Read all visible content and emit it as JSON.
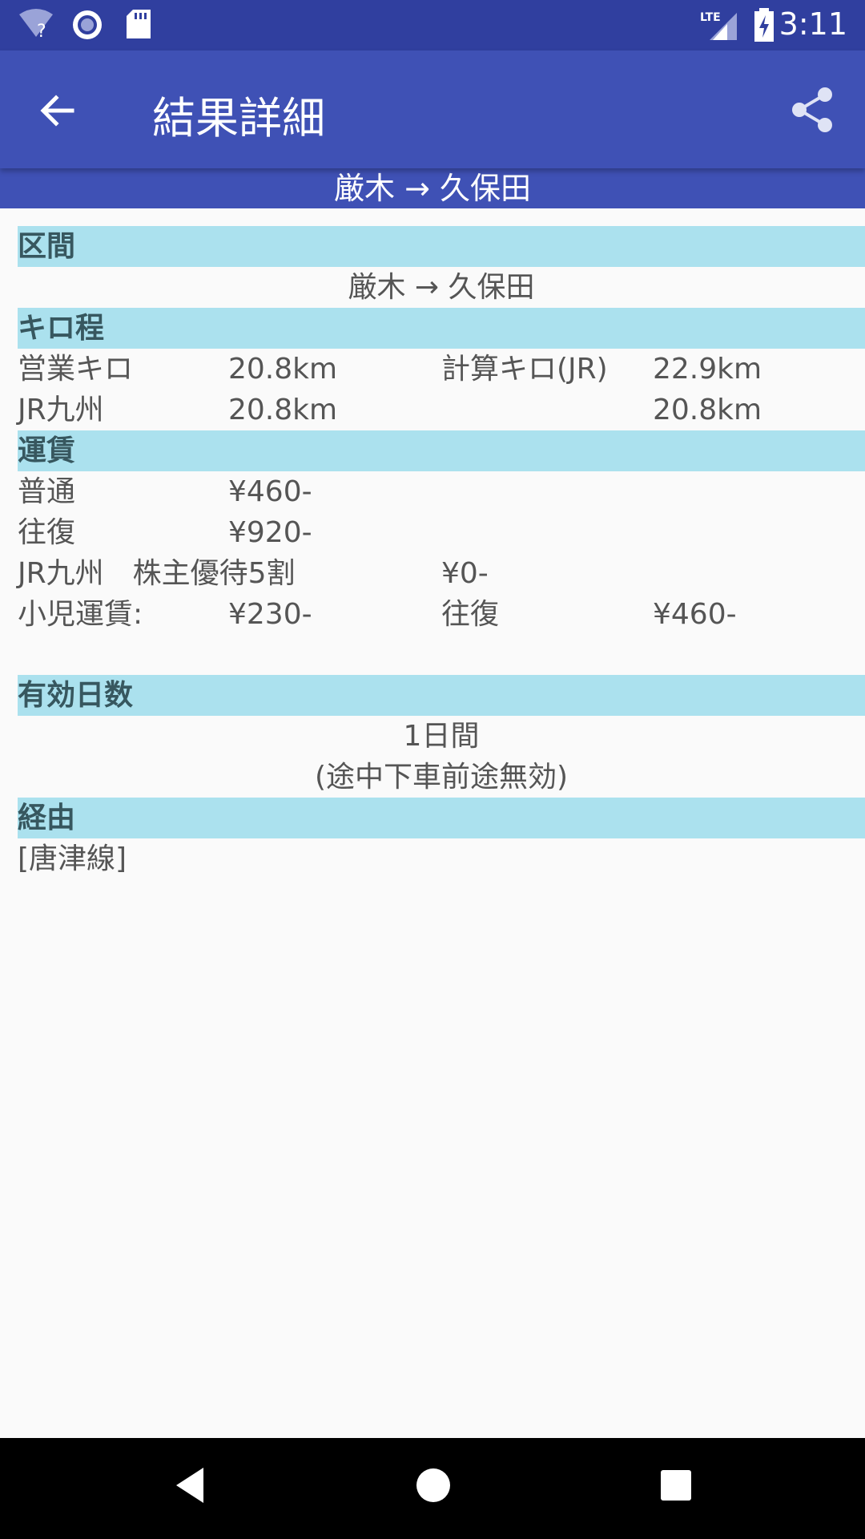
{
  "status_bar": {
    "time": "3:11",
    "network_label": "LTE",
    "icons": [
      "wifi-question-icon",
      "sync-circle-icon",
      "sd-card-icon",
      "signal-icon",
      "battery-charging-icon"
    ]
  },
  "app_bar": {
    "title": "結果詳細",
    "back_icon": "arrow-back-icon",
    "share_icon": "share-icon"
  },
  "route_header": "厳木 → 久保田",
  "sections": {
    "kukan": {
      "title": "区間",
      "value": "厳木 → 久保田"
    },
    "kilo": {
      "title": "キロ程",
      "rows": [
        [
          "営業キロ",
          "20.8km",
          "計算キロ(JR)",
          "22.9km"
        ],
        [
          "JR九州",
          "20.8km",
          "",
          "20.8km"
        ]
      ]
    },
    "fare": {
      "title": "運賃",
      "rows": [
        [
          "普通",
          "¥460-",
          "",
          ""
        ],
        [
          "往復",
          "¥920-",
          "",
          ""
        ],
        [
          "JR九州　株主優待5割",
          "",
          "¥0-",
          ""
        ],
        [
          "小児運賃:",
          "¥230-",
          "往復",
          "¥460-"
        ]
      ]
    },
    "validity": {
      "title": "有効日数",
      "days": "1日間",
      "note": "(途中下車前途無効)"
    },
    "route": {
      "title": "経由",
      "value": "[唐津線]"
    }
  },
  "colors": {
    "status_bar": "#303f9f",
    "app_bar": "#3f51b5",
    "section_header": "#abe1ee"
  }
}
